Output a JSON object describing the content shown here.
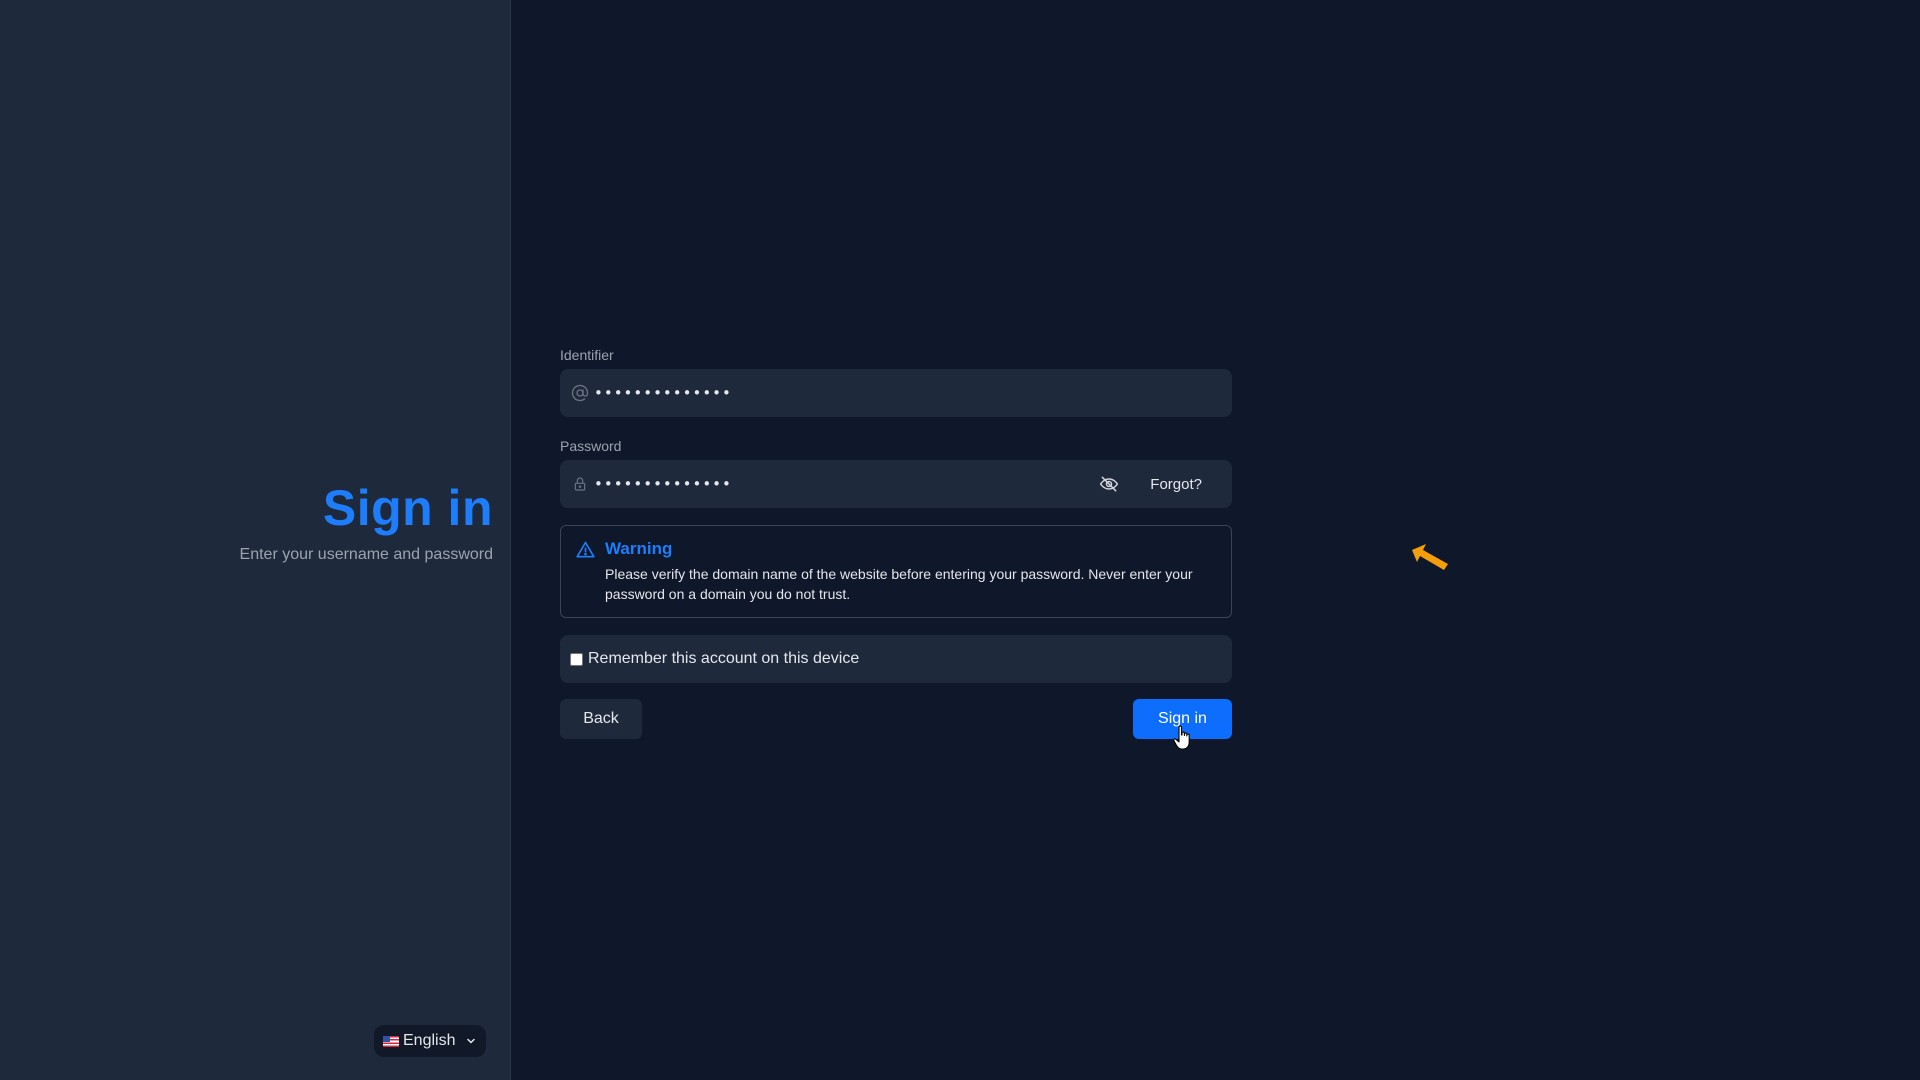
{
  "branding": {
    "title": "Sign in",
    "subtitle": "Enter your username and password"
  },
  "language": {
    "selected": "English",
    "flag": "us-flag-icon"
  },
  "form": {
    "identifier": {
      "label": "Identifier",
      "value": "••••••••••••••",
      "icon": "at-sign-icon"
    },
    "password": {
      "label": "Password",
      "value": "••••••••••••••",
      "icon": "lock-icon",
      "toggle_icon": "eye-off-icon",
      "forgot_label": "Forgot?"
    },
    "warning": {
      "title": "Warning",
      "text": "Please verify the domain name of the website before entering your password. Never enter your password on a domain you do not trust.",
      "icon": "warning-triangle-icon"
    },
    "remember": {
      "label": "Remember this account on this device",
      "checked": false
    },
    "actions": {
      "back_label": "Back",
      "submit_label": "Sign in"
    }
  },
  "colors": {
    "accent": "#1d7dfa",
    "primary_button": "#0d6efd",
    "background": "#0f172a",
    "panel": "#1e293b",
    "annotation_arrow": "#f59e0b"
  }
}
